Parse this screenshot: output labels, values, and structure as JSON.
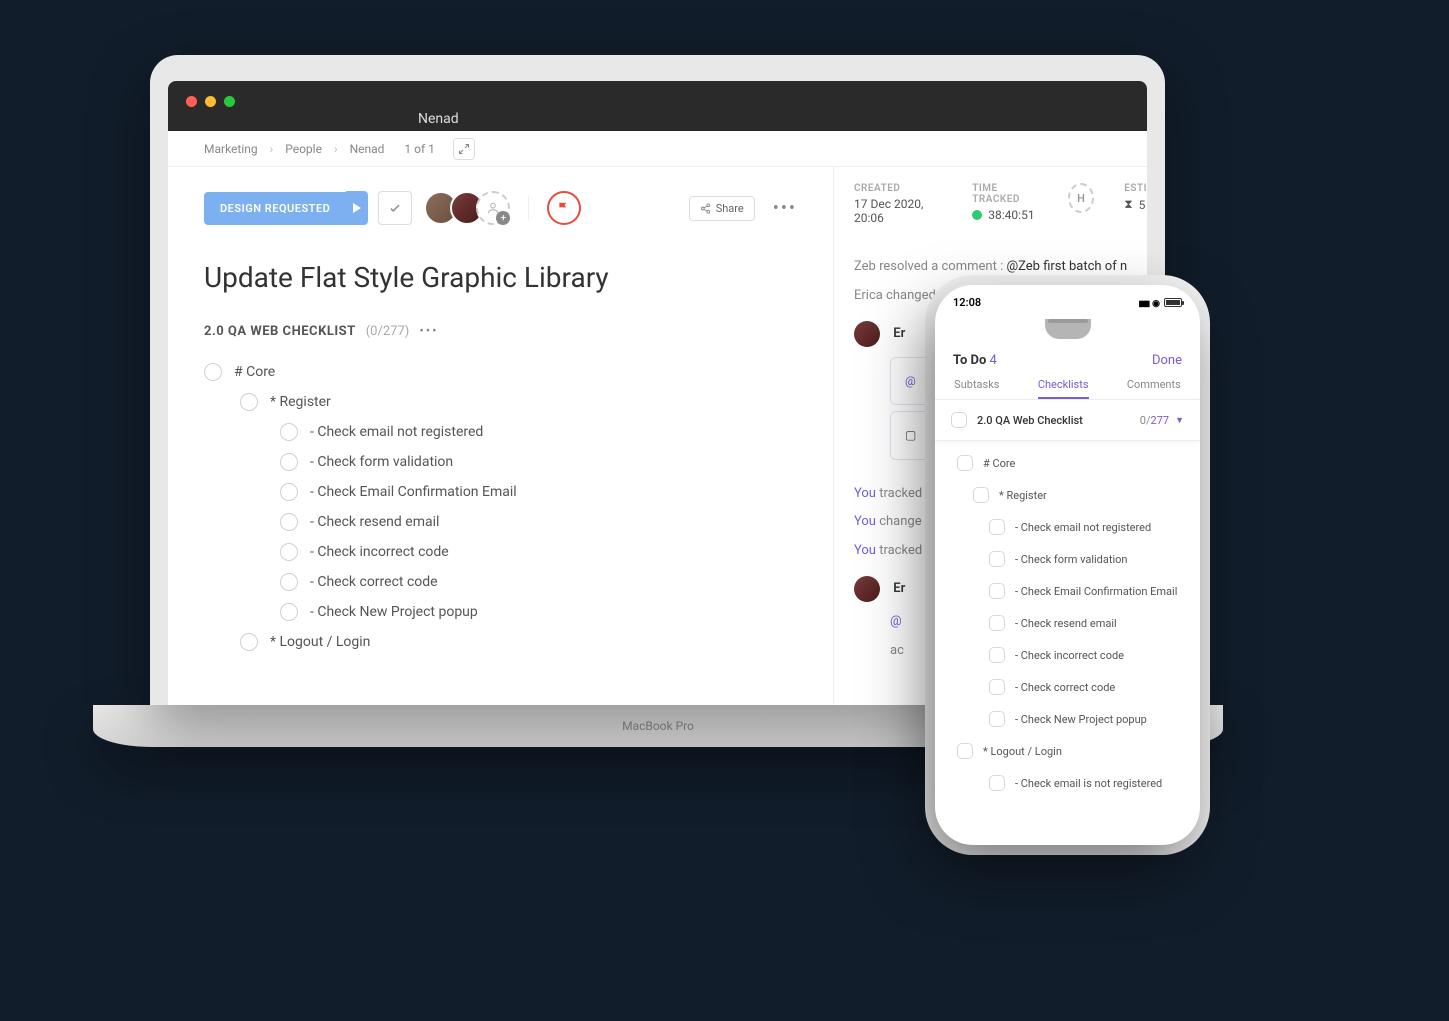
{
  "macbook_label": "MacBook Pro",
  "browser_tab": "Nenad",
  "breadcrumb": {
    "a": "Marketing",
    "b": "People",
    "c": "Nenad",
    "pager": "1 of 1"
  },
  "status_button": "DESIGN REQUESTED",
  "share_label": "Share",
  "task_title": "Update Flat Style Graphic Library",
  "checklist": {
    "name": "2.0 QA WEB CHECKLIST",
    "count": "(0/277)"
  },
  "items": {
    "core": "# Core",
    "register": "* Register",
    "r1": "- Check email not registered",
    "r2": "- Check form validation",
    "r3": "- Check Email Confirmation Email",
    "r4": "- Check resend email",
    "r5": "- Check incorrect code",
    "r6": "- Check correct code",
    "r7": "- Check New Project popup",
    "logout": "* Logout / Login"
  },
  "side": {
    "created_label": "CREATED",
    "created_val": "17 Dec 2020, 20:06",
    "tracked_label": "TIME TRACKED",
    "tracked_val": "38:40:51",
    "estimate_label": "ESTI",
    "estimate_val": "5",
    "hbox": "H",
    "activity1_pre": "Zeb resolved a comment : ",
    "activity1_mention": "@Zeb first batch of n",
    "activity2": "Erica changed",
    "you_tracked": "You tracked",
    "you_changed": "You change",
    "comment_name": "Er",
    "comment_mention": "@",
    "comment_body": "ac"
  },
  "phone": {
    "time": "12:08",
    "todo_label": "To Do ",
    "todo_n": "4",
    "done": "Done",
    "tab_subtasks": "Subtasks",
    "tab_checklists": "Checklists",
    "tab_comments": "Comments",
    "section_label": "2.0 QA Web Checklist",
    "section_done": "0/",
    "section_total": "277",
    "items": {
      "core": "# Core",
      "register": "* Register",
      "r1": "- Check email not registered",
      "r2": "- Check form validation",
      "r3": "- Check Email Confirmation Email",
      "r4": "- Check resend email",
      "r5": "- Check incorrect code",
      "r6": "- Check correct code",
      "r7": "- Check New Project popup",
      "logout": "* Logout / Login",
      "l1": "- Check email is not registered"
    }
  }
}
